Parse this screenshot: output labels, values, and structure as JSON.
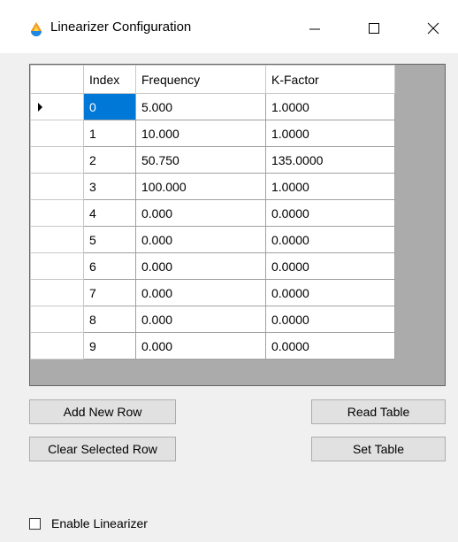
{
  "window": {
    "title": "Linearizer Configuration",
    "icon": "color-drop-app-icon",
    "controls": {
      "minimize": "minimize-icon",
      "maximize": "maximize-icon",
      "close": "close-icon"
    }
  },
  "grid": {
    "columns": [
      "Index",
      "Frequency",
      "K-Factor"
    ],
    "rows": [
      {
        "index": "0",
        "frequency": "5.000",
        "kfactor": "1.0000"
      },
      {
        "index": "1",
        "frequency": "10.000",
        "kfactor": "1.0000"
      },
      {
        "index": "2",
        "frequency": "50.750",
        "kfactor": "135.0000"
      },
      {
        "index": "3",
        "frequency": "100.000",
        "kfactor": "1.0000"
      },
      {
        "index": "4",
        "frequency": "0.000",
        "kfactor": "0.0000"
      },
      {
        "index": "5",
        "frequency": "0.000",
        "kfactor": "0.0000"
      },
      {
        "index": "6",
        "frequency": "0.000",
        "kfactor": "0.0000"
      },
      {
        "index": "7",
        "frequency": "0.000",
        "kfactor": "0.0000"
      },
      {
        "index": "8",
        "frequency": "0.000",
        "kfactor": "0.0000"
      },
      {
        "index": "9",
        "frequency": "0.000",
        "kfactor": "0.0000"
      }
    ],
    "current_row": 0,
    "selection_color": "#0078d7"
  },
  "buttons": {
    "add_new_row": "Add New Row",
    "clear_selected_row": "Clear Selected Row",
    "read_table": "Read Table",
    "set_table": "Set Table"
  },
  "enable_linearizer": {
    "label": "Enable Linearizer",
    "checked": false
  }
}
